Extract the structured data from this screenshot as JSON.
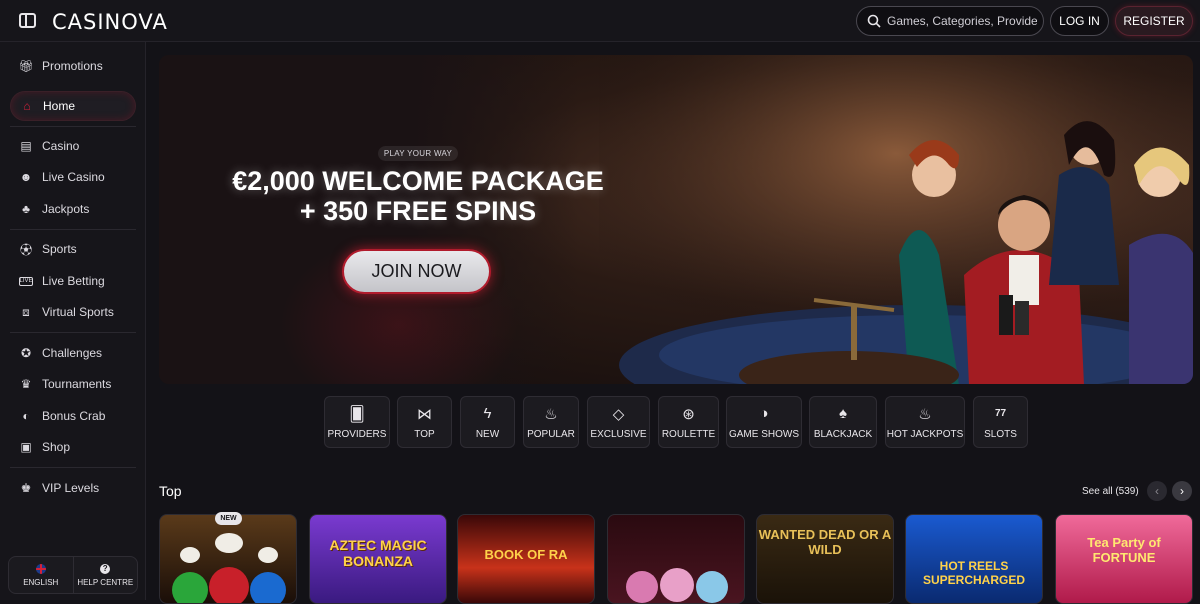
{
  "header": {
    "logo": "CASINOVA",
    "search_placeholder": "Games, Categories, Providers",
    "login_label": "LOG IN",
    "register_label": "REGISTER"
  },
  "sidebar": {
    "items": [
      {
        "label": "Promotions",
        "icon": "gift-icon"
      },
      {
        "label": "Home",
        "icon": "home-icon",
        "active": true
      },
      {
        "label": "Casino",
        "icon": "slot-machine-icon"
      },
      {
        "label": "Live Casino",
        "icon": "live-dealer-icon"
      },
      {
        "label": "Jackpots",
        "icon": "clover-icon"
      },
      {
        "label": "Sports",
        "icon": "soccer-ball-icon"
      },
      {
        "label": "Live Betting",
        "icon": "live-badge-icon"
      },
      {
        "label": "Virtual Sports",
        "icon": "virtual-sports-icon"
      },
      {
        "label": "Challenges",
        "icon": "medal-icon"
      },
      {
        "label": "Tournaments",
        "icon": "trophy-icon"
      },
      {
        "label": "Bonus Crab",
        "icon": "claw-icon"
      },
      {
        "label": "Shop",
        "icon": "shop-icon"
      },
      {
        "label": "VIP Levels",
        "icon": "crown-icon"
      }
    ],
    "language_label": "ENGLISH",
    "help_label": "HELP CENTRE"
  },
  "hero": {
    "tag": "PLAY YOUR WAY",
    "title_line1": "€2,000 WELCOME PACKAGE",
    "title_line2": "+ 350 FREE SPINS",
    "cta": "JOIN NOW"
  },
  "categories": [
    {
      "label": "PROVIDERS",
      "icon": "cards-icon"
    },
    {
      "label": "TOP",
      "icon": "bow-tie-icon"
    },
    {
      "label": "NEW",
      "icon": "lightning-icon"
    },
    {
      "label": "POPULAR",
      "icon": "flame-icon"
    },
    {
      "label": "EXCLUSIVE",
      "icon": "diamond-icon"
    },
    {
      "label": "ROULETTE",
      "icon": "roulette-icon"
    },
    {
      "label": "GAME SHOWS",
      "icon": "mask-icon"
    },
    {
      "label": "BLACKJACK",
      "icon": "playing-cards-icon"
    },
    {
      "label": "HOT JACKPOTS",
      "icon": "hot-flame-icon"
    },
    {
      "label": "SLOTS",
      "icon": "777-icon"
    }
  ],
  "top_section": {
    "title": "Top",
    "see_all": "See all (539)",
    "badge_new": "NEW",
    "games": [
      {
        "name": "",
        "color": "#3a2a1a"
      },
      {
        "name": "AZTEC MAGIC BONANZA",
        "color": "#5a2a9a"
      },
      {
        "name": "BOOK OF RA",
        "color": "#7a1a14"
      },
      {
        "name": "",
        "color": "#3a1218"
      },
      {
        "name": "WANTED DEAD OR A WILD",
        "color": "#3a2a14"
      },
      {
        "name": "HOT REELS SUPERCHARGED",
        "color": "#0f3a7a"
      },
      {
        "name": "Tea Party of FORTUNE",
        "color": "#d8366a"
      }
    ]
  }
}
